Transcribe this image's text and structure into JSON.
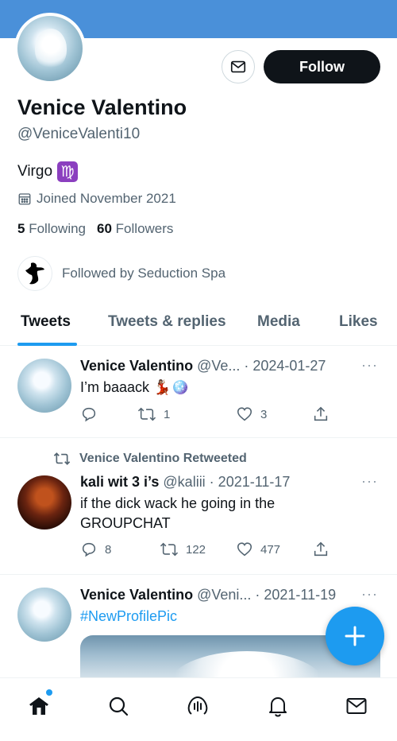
{
  "profile": {
    "name": "Venice Valentino",
    "handle": "@VeniceValenti10",
    "bio_text": "Virgo",
    "bio_emoji": "♍",
    "joined": "Joined November 2021",
    "following_count": "5",
    "following_label": "Following",
    "followers_count": "60",
    "followers_label": "Followers",
    "followed_by": "Followed by Seduction Spa",
    "follow_label": "Follow"
  },
  "tabs": [
    {
      "label": "Tweets",
      "active": true
    },
    {
      "label": "Tweets & replies",
      "active": false
    },
    {
      "label": "Media",
      "active": false
    },
    {
      "label": "Likes",
      "active": false
    }
  ],
  "tweets": [
    {
      "name": "Venice Valentino",
      "meta": "@Ve... · 2024-01-27",
      "text": "I’m baaack 💃🏽🪩",
      "reply_count": "",
      "retweet_count": "1",
      "like_count": "3"
    },
    {
      "retweeted_by": "Venice Valentino Retweeted",
      "name": "kali wit 3 i’s",
      "meta": "@kaliii · 2021-11-17",
      "text_line1": "if the dick wack he going in the",
      "text_line2": "GROUPCHAT",
      "reply_count": "8",
      "retweet_count": "122",
      "like_count": "477"
    },
    {
      "name": "Venice Valentino",
      "meta": "@Veni... · 2021-11-19",
      "text": "#NewProfilePic"
    }
  ],
  "colors": {
    "banner": "#4a90d9",
    "accent": "#1d9bf0",
    "text": "#0f1419",
    "muted": "#536471"
  },
  "icons": {
    "more": "···"
  }
}
